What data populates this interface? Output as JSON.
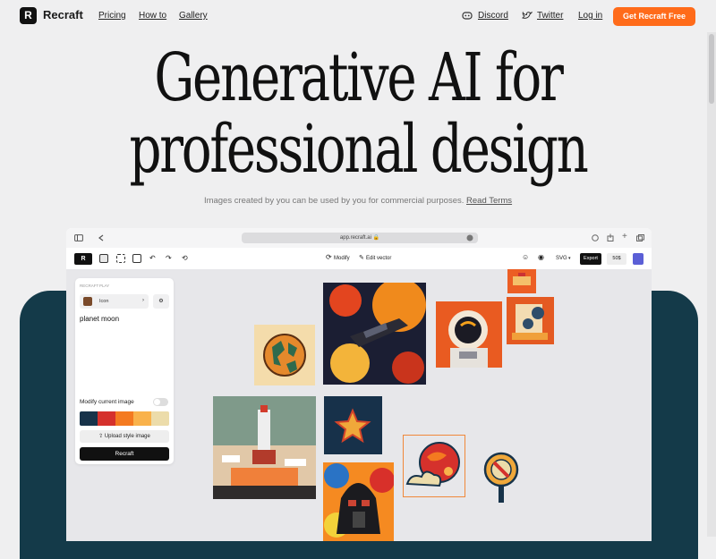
{
  "nav": {
    "logo_text": "Recraft",
    "links": [
      "Pricing",
      "How to",
      "Gallery"
    ],
    "discord": "Discord",
    "twitter": "Twitter",
    "login": "Log in",
    "cta": "Get Recraft Free"
  },
  "hero": {
    "line1": "Generative AI for",
    "line2": "professional design",
    "subtitle": "Images created by you can be used by you for commercial purposes.",
    "terms_link": "Read Terms"
  },
  "app": {
    "url": "app.recraft.ai",
    "toolbar": {
      "modify": "Modify",
      "edit_vector": "Edit vector",
      "format": "SVG",
      "export": "Export",
      "count": "50$"
    },
    "panel": {
      "small_left": "RECRAFT",
      "small_right": "PLAY",
      "style_label": "Icon",
      "chevron": "›",
      "prompt": "planet moon",
      "modify_label": "Modify current image",
      "upload_label": "Upload style image",
      "recraft_button": "Recraft",
      "palette": [
        "#17334a",
        "#d5312c",
        "#f47a20",
        "#f9b24b",
        "#ecdcaa"
      ]
    }
  },
  "colors": {
    "accent": "#ff6b1a",
    "dark_band": "#143a49"
  }
}
